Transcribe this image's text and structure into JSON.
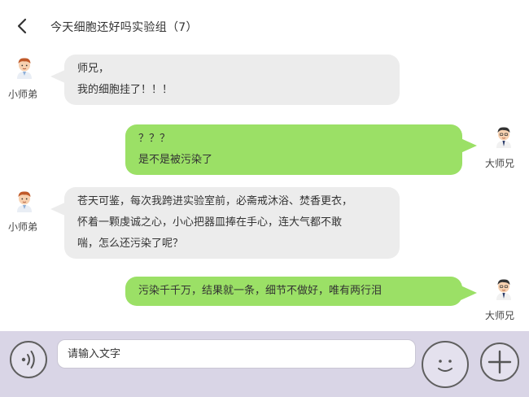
{
  "header": {
    "title": "今天细胞还好吗实验组（7）"
  },
  "messages": [
    {
      "side": "left",
      "sender": "小师弟",
      "lines": [
        "师兄，",
        "我的细胞挂了！！！"
      ]
    },
    {
      "side": "right",
      "sender": "大师兄",
      "lines": [
        "？？？",
        "是不是被污染了"
      ]
    },
    {
      "side": "left",
      "sender": "小师弟",
      "lines": [
        "苍天可鉴，每次我跨进实验室前，必斋戒沐浴、焚香更衣，",
        "怀着一颗虔诚之心，小心把器皿捧在手心，连大气都不敢",
        "喘，怎么还污染了呢？"
      ]
    },
    {
      "side": "right",
      "sender": "大师兄",
      "lines": [
        "污染千千万，结果就一条，细节不做好，唯有两行泪"
      ]
    }
  ],
  "input": {
    "placeholder": "请输入文字",
    "value": ""
  },
  "icons": {
    "back": "chevron-left-icon",
    "voice": "voice-wave-icon",
    "emoji": "smiley-face-icon",
    "plus": "plus-icon"
  },
  "colors": {
    "left_bubble": "#ececec",
    "right_bubble": "#9be066",
    "input_bar": "#d9d5e6"
  }
}
